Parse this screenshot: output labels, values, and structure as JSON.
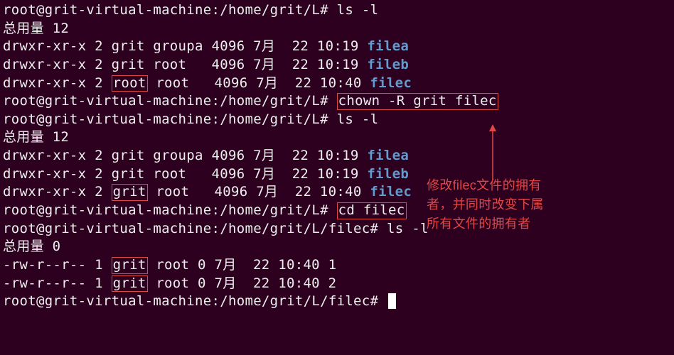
{
  "prompt_user": "root",
  "prompt_sep": "@",
  "prompt_host": "grit-virtual-machine",
  "prompt_path1": ":/home/grit/L#",
  "prompt_path2": ":/home/grit/L/filec#",
  "cmd_ls": "ls -l",
  "cmd_chown": "chown -R grit filec",
  "cmd_cd": "cd filec",
  "total_label": "总用量",
  "total12": "12",
  "total0": "0",
  "ls1": {
    "a_perm": "drwxr-xr-x 2 ",
    "a_own": "grit groupa ",
    "a_rest": "4096 7月  22 10:19 ",
    "a_name": "filea",
    "b_perm": "drwxr-xr-x 2 ",
    "b_own": "grit root   ",
    "b_rest": "4096 7月  22 10:19 ",
    "b_name": "fileb",
    "c_perm": "drwxr-xr-x 2 ",
    "c_own_pre": "root",
    "c_own_post": " root   ",
    "c_rest": "4096 7月  22 10:40 ",
    "c_name": "filec"
  },
  "ls2": {
    "a_perm": "drwxr-xr-x 2 ",
    "a_own": "grit groupa ",
    "a_rest": "4096 7月  22 10:19 ",
    "a_name": "filea",
    "b_perm": "drwxr-xr-x 2 ",
    "b_own": "grit root   ",
    "b_rest": "4096 7月  22 10:19 ",
    "b_name": "fileb",
    "c_perm": "drwxr-xr-x 2 ",
    "c_own_pre": "grit",
    "c_own_post": " root   ",
    "c_rest": "4096 7月  22 10:40 ",
    "c_name": "filec"
  },
  "ls3": {
    "a_perm": "-rw-r--r-- 1 ",
    "a_own_pre": "grit",
    "a_own_post": " root 0 7月  22 10:40 1",
    "b_perm": "-rw-r--r-- 1 ",
    "b_own_pre": "grit",
    "b_own_post": " root 0 7月  22 10:40 2"
  },
  "annotation": {
    "l1": "修改filec文件的拥有",
    "l2": "者，并同时改变下属",
    "l3": "所有文件的拥有者"
  }
}
